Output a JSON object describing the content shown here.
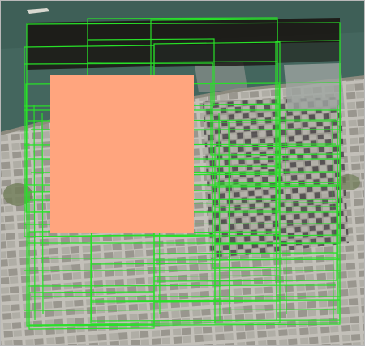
{
  "colors": {
    "water": "#44665e",
    "water_dark": "#35524b",
    "shore": "#8c8a7e",
    "city_base": "#8e8d86",
    "block_light": "#b3b0a8",
    "block_mid": "#9a978f",
    "block_dark": "#4a4548",
    "street": "#c9c6bf",
    "park": "#6f7c57",
    "footprint_stroke": "#28e028",
    "footprint_fill_dark": "#191511",
    "selected_footprint": "#ffa57e",
    "frame_border": "#b9b9b9"
  },
  "map_layers": {
    "basemap": "satellite-imagery",
    "footprints": "image-footprints",
    "selection": "selected-footprint"
  }
}
